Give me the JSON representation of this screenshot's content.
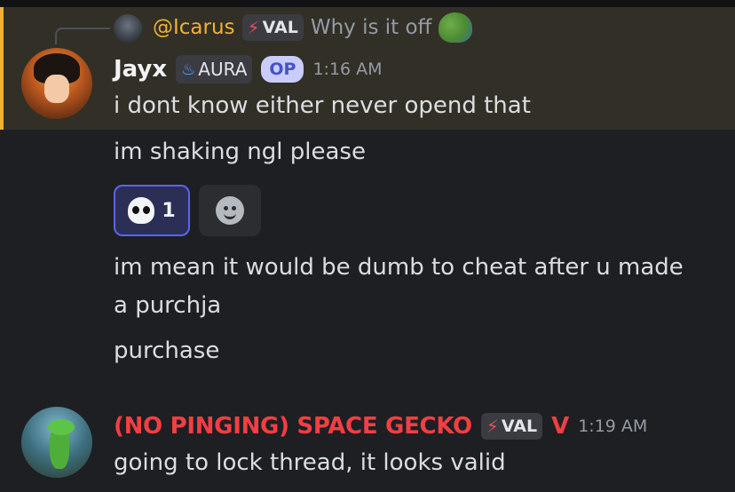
{
  "reply": {
    "username": "@Icarus",
    "tag": "VAL",
    "text": "Why is it off",
    "emoji_icon": "pepe-emoji-icon"
  },
  "message1": {
    "username": "Jayx",
    "tag": "AURA",
    "op_badge": "OP",
    "timestamp": "1:16 AM",
    "lines": [
      "i dont know either never opend that",
      "im shaking ngl please"
    ],
    "reaction": {
      "emoji": "skull-icon",
      "count": "1"
    },
    "more_lines": [
      "im mean it would be dumb to cheat after u made",
      "a purchja",
      "purchase"
    ]
  },
  "message2": {
    "username": "(NO PINGING) SPACE GECKO",
    "tag": "VAL",
    "role_icon": "valorant-icon",
    "timestamp": "1:19 AM",
    "text": "going to lock thread, it looks valid"
  },
  "colors": {
    "background": "#1e1f23",
    "highlight": "#322f27",
    "highlight_border": "#f0b232",
    "reply_name": "#f0b232",
    "gecko_name": "#f23f43",
    "reaction_border": "#5865f2"
  }
}
